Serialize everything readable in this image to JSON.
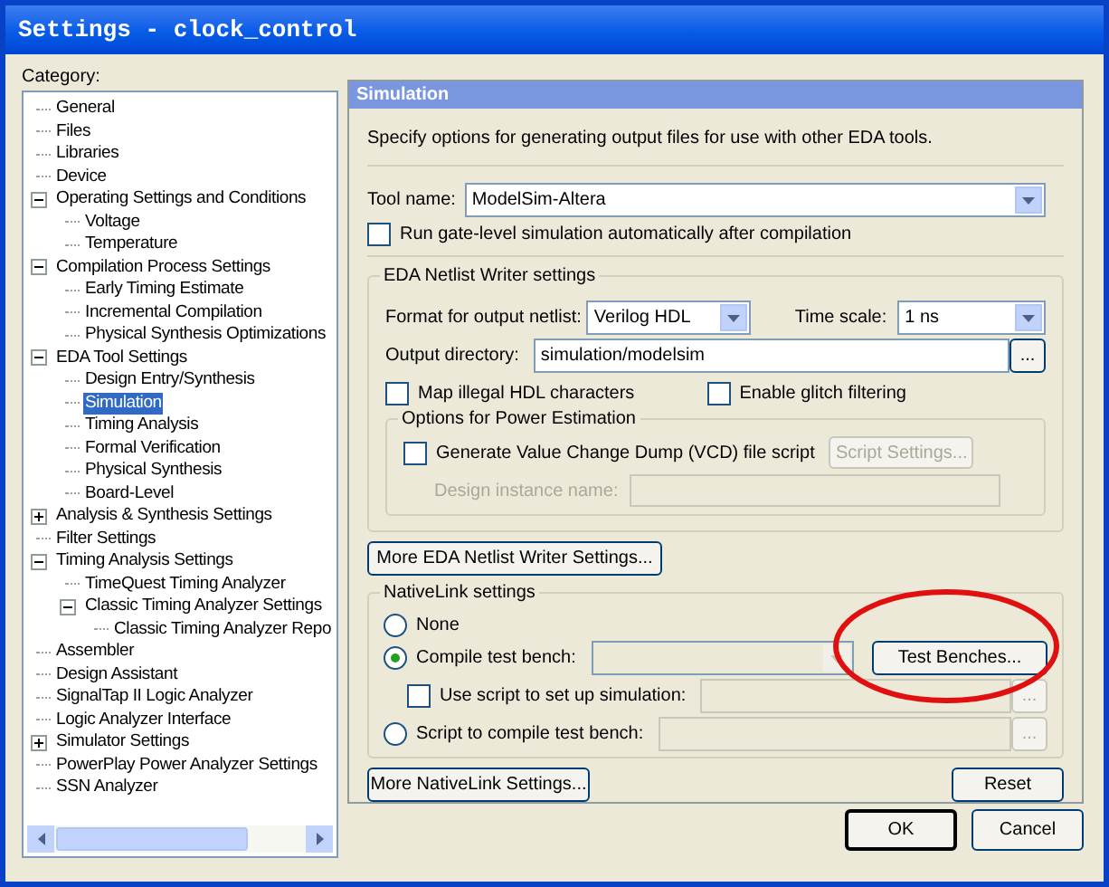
{
  "window": {
    "title": "Settings - clock_control"
  },
  "category": {
    "label": "Category:",
    "tree": [
      {
        "label": "General",
        "selected": false
      },
      {
        "label": "Files",
        "selected": false
      },
      {
        "label": "Libraries",
        "selected": false
      },
      {
        "label": "Device",
        "selected": false
      },
      {
        "label": "Operating Settings and Conditions",
        "selected": false,
        "expanded": true,
        "children": [
          {
            "label": "Voltage",
            "selected": false
          },
          {
            "label": "Temperature",
            "selected": false
          }
        ]
      },
      {
        "label": "Compilation Process Settings",
        "selected": false,
        "expanded": true,
        "children": [
          {
            "label": "Early Timing Estimate",
            "selected": false
          },
          {
            "label": "Incremental Compilation",
            "selected": false
          },
          {
            "label": "Physical Synthesis Optimizations",
            "selected": false
          }
        ]
      },
      {
        "label": "EDA Tool Settings",
        "selected": false,
        "expanded": true,
        "children": [
          {
            "label": "Design Entry/Synthesis",
            "selected": false
          },
          {
            "label": "Simulation",
            "selected": true
          },
          {
            "label": "Timing Analysis",
            "selected": false
          },
          {
            "label": "Formal Verification",
            "selected": false
          },
          {
            "label": "Physical Synthesis",
            "selected": false
          },
          {
            "label": "Board-Level",
            "selected": false
          }
        ]
      },
      {
        "label": "Analysis & Synthesis Settings",
        "selected": false,
        "expanded": false
      },
      {
        "label": "Filter Settings",
        "selected": false
      },
      {
        "label": "Timing Analysis Settings",
        "selected": false,
        "expanded": true,
        "children": [
          {
            "label": "TimeQuest Timing Analyzer",
            "selected": false
          },
          {
            "label": "Classic Timing Analyzer Settings",
            "selected": false,
            "expanded": true,
            "children": [
              {
                "label": "Classic Timing Analyzer Repo",
                "selected": false
              }
            ]
          }
        ]
      },
      {
        "label": "Assembler",
        "selected": false
      },
      {
        "label": "Design Assistant",
        "selected": false
      },
      {
        "label": "SignalTap II Logic Analyzer",
        "selected": false
      },
      {
        "label": "Logic Analyzer Interface",
        "selected": false
      },
      {
        "label": "Simulator Settings",
        "selected": false,
        "expanded": false
      },
      {
        "label": "PowerPlay Power Analyzer Settings",
        "selected": false
      },
      {
        "label": "SSN Analyzer",
        "selected": false
      }
    ]
  },
  "panel": {
    "title": "Simulation",
    "description": "Specify options for generating output files for use with other EDA tools.",
    "tool_name": {
      "label": "Tool name:",
      "value": "ModelSim-Altera"
    },
    "run_gate_level": {
      "label": "Run gate-level simulation automatically after compilation",
      "checked": false
    },
    "netlist": {
      "title": "EDA Netlist Writer settings",
      "format": {
        "label": "Format for output netlist:",
        "value": "Verilog HDL"
      },
      "time_scale": {
        "label": "Time scale:",
        "value": "1 ns"
      },
      "output_directory": {
        "label": "Output directory:",
        "value": "simulation/modelsim",
        "browse": "..."
      },
      "map_illegal": {
        "label": "Map illegal HDL characters",
        "checked": false
      },
      "glitch": {
        "label": "Enable glitch filtering",
        "checked": false
      },
      "power": {
        "title": "Options for Power Estimation",
        "vcd": {
          "label": "Generate Value Change Dump (VCD) file script",
          "checked": false
        },
        "script_settings": {
          "label": "Script Settings...",
          "disabled": true
        },
        "instance": {
          "label": "Design instance name:",
          "disabled": true
        }
      }
    },
    "more_netlist": "More EDA Netlist Writer Settings...",
    "nativelink": {
      "title": "NativeLink settings",
      "none": {
        "label": "None",
        "selected": false
      },
      "compile": {
        "label": "Compile test bench:",
        "selected": true,
        "button": "Test Benches..."
      },
      "use_script": {
        "label": "Use script to set up simulation:",
        "checked": false,
        "browse": "..."
      },
      "script": {
        "label": "Script to compile test bench:",
        "selected": false,
        "browse": "..."
      }
    },
    "more_nativelink": "More NativeLink Settings...",
    "reset": "Reset"
  },
  "buttons": [
    {
      "label": "OK",
      "default": true
    },
    {
      "label": "Cancel",
      "default": false
    }
  ]
}
